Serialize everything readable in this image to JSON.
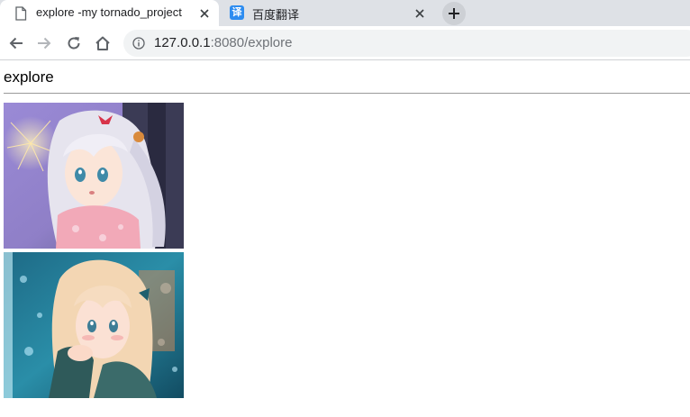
{
  "browser": {
    "tabs": [
      {
        "title": "explore -my tornado_project",
        "icon": "document-icon",
        "active": true
      },
      {
        "title": "百度翻译",
        "icon": "baidu-translate-icon",
        "icon_text": "译",
        "active": false
      }
    ],
    "url_host": "127.0.0.1",
    "url_rest": ":8080/explore",
    "colors": {
      "tabstrip": "#dee1e6",
      "omnibox": "#f1f3f4",
      "baidu_icon": "#2d8cf0"
    }
  },
  "page": {
    "title": "explore",
    "images": [
      {
        "description": "anime girl with silver hair and kimono, fireworks"
      },
      {
        "description": "anime girl with blonde hair, blue bokeh background"
      }
    ]
  }
}
